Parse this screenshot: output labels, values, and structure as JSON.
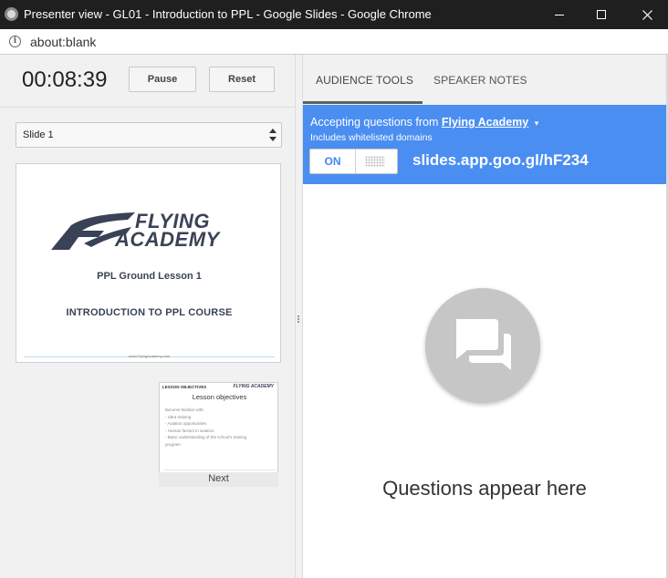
{
  "window": {
    "title": "Presenter view - GL01 - Introduction to PPL - Google Slides - Google Chrome",
    "controls": [
      "minimize-icon",
      "maximize-icon",
      "close-icon"
    ]
  },
  "address_bar": {
    "url": "about:blank",
    "icon": "info-icon"
  },
  "presenter": {
    "timer": "00:08:39",
    "pause_label": "Pause",
    "reset_label": "Reset",
    "slide_select": {
      "selected": "Slide 1"
    },
    "current_slide": {
      "logo_line1": "FLYING",
      "logo_line2": "ACADEMY",
      "subtitle": "PPL Ground Lesson 1",
      "title": "INTRODUCTION TO PPL COURSE",
      "footer": "www.FlyingAcademy.com"
    },
    "next_slide": {
      "header": "LESSON OBJECTIVES",
      "logo": "FLYING ACADEMY",
      "title": "Lesson objectives",
      "body": [
        "Become familiar with:",
        "- Ultra training",
        "- Aviation opportunities",
        "- Human factors in aviation",
        "- Basic understanding of the school's training",
        "  program"
      ],
      "label": "Next"
    }
  },
  "audience_panel": {
    "tabs": [
      {
        "label": "AUDIENCE TOOLS",
        "active": true
      },
      {
        "label": "SPEAKER NOTES",
        "active": false
      }
    ],
    "banner": {
      "accepting_prefix": "Accepting questions from",
      "group": "Flying Academy",
      "caret": "▾",
      "note": "Includes whitelisted domains",
      "toggle_state": "ON",
      "short_url": "slides.app.goo.gl/hF234",
      "color": "#4a8ef1"
    },
    "empty_state": {
      "icon": "questions-chat-icon",
      "message": "Questions appear here"
    }
  }
}
